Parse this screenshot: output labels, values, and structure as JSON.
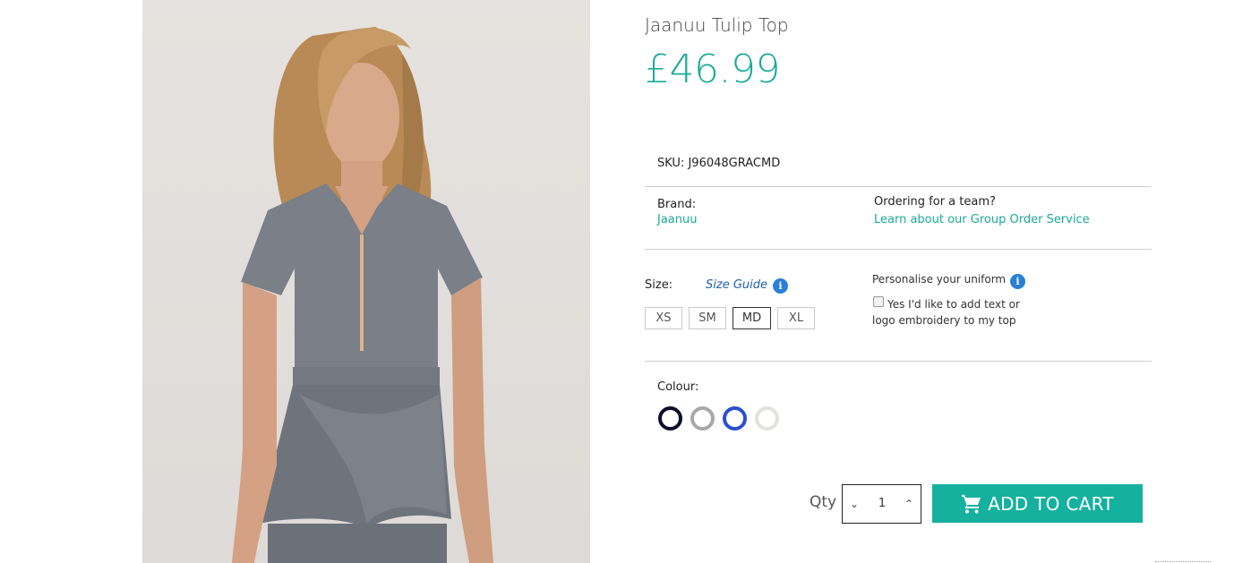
{
  "product": {
    "title": "Jaanuu Tulip Top",
    "price": "£46.99",
    "image_icon": "product-photo",
    "sku_label": "SKU:",
    "sku_value": "J96048GRACMD"
  },
  "brand": {
    "label": "Brand:",
    "value": "Jaanuu"
  },
  "team": {
    "label": "Ordering for a team?",
    "link": "Learn about our Group Order Service"
  },
  "size": {
    "label": "Size:",
    "guide_label": "Size Guide",
    "info_glyph": "i",
    "options": [
      "XS",
      "SM",
      "MD",
      "XL"
    ],
    "selected": "MD"
  },
  "personalise": {
    "label": "Personalise your uniform",
    "info_glyph": "i",
    "checkbox_text": "Yes I'd like to add text or logo embroidery to my top",
    "checked": false
  },
  "colour": {
    "label": "Colour:",
    "swatches": [
      "#0d0f2a",
      "#a8a8a8",
      "#2a4fd0",
      "#e3e1dd"
    ]
  },
  "cart": {
    "qty_label": "Qty",
    "qty_value": "1",
    "minus_glyph": "⌄",
    "plus_glyph": "⌃",
    "button_label": "ADD TO CART",
    "button_icon": "cart-icon"
  },
  "colors": {
    "accent": "#1aaa98",
    "button": "#15b19e",
    "link_blue": "#1f5fb0"
  }
}
